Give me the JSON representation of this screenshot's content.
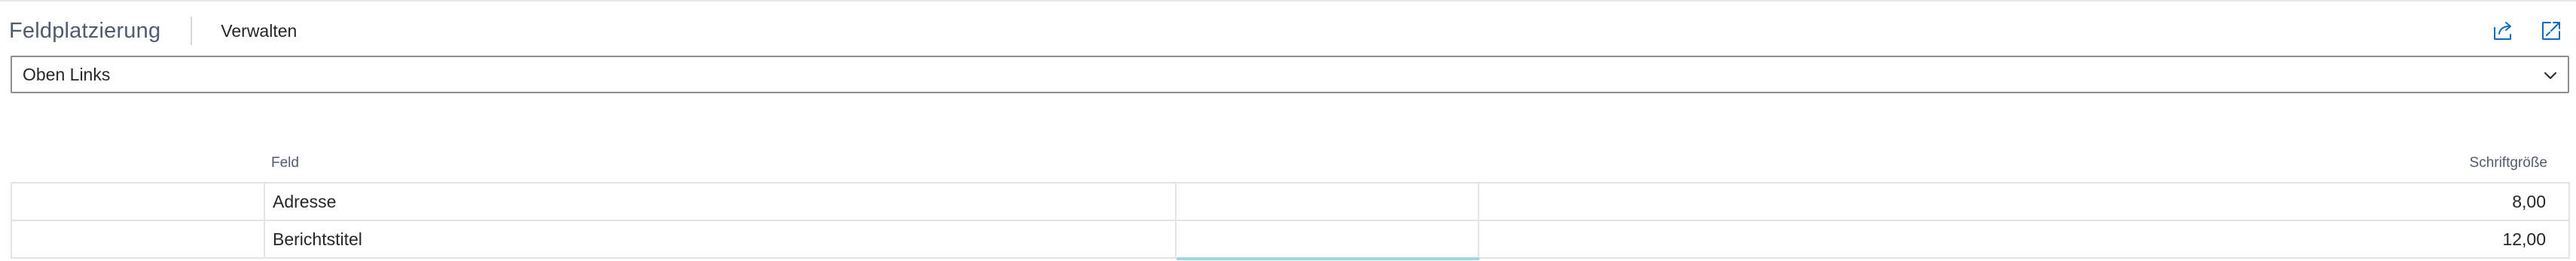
{
  "header": {
    "title": "Feldplatzierung",
    "manage_label": "Verwalten",
    "icons": [
      "share-icon",
      "expand-icon"
    ]
  },
  "dropdown": {
    "selected": "Oben Links"
  },
  "table": {
    "columns": {
      "field": "Feld",
      "font_size": "Schriftgröße"
    },
    "rows": [
      {
        "field": "Adresse",
        "empty": "",
        "font_size": "8,00"
      },
      {
        "field": "Berichtstitel",
        "empty": "",
        "font_size": "12,00"
      }
    ]
  },
  "colors": {
    "accent": "#0f6cbd",
    "title_text": "#505c6d",
    "border": "#e4e4e4",
    "focus": "#9fd6e2"
  }
}
